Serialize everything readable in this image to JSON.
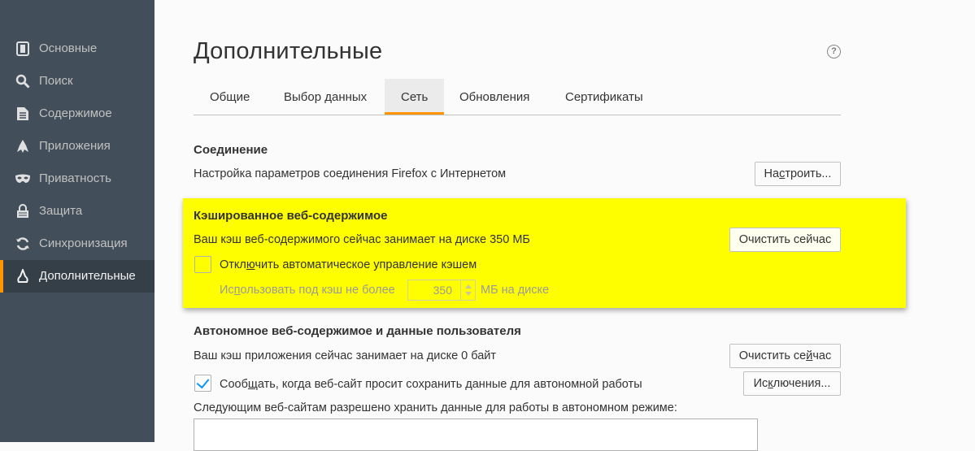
{
  "sidebar": {
    "items": [
      {
        "label": "Основные",
        "icon": "general-icon"
      },
      {
        "label": "Поиск",
        "icon": "search-icon"
      },
      {
        "label": "Содержимое",
        "icon": "content-icon"
      },
      {
        "label": "Приложения",
        "icon": "applications-icon"
      },
      {
        "label": "Приватность",
        "icon": "privacy-mask-icon"
      },
      {
        "label": "Защита",
        "icon": "security-icon"
      },
      {
        "label": "Синхронизация",
        "icon": "sync-icon"
      },
      {
        "label": "Дополнительные",
        "icon": "advanced-icon",
        "active": true
      }
    ]
  },
  "page": {
    "title": "Дополнительные",
    "help": "?"
  },
  "tabs": [
    {
      "label": "Общие"
    },
    {
      "label": "Выбор данных"
    },
    {
      "label": "Сеть",
      "selected": true
    },
    {
      "label": "Обновления"
    },
    {
      "label": "Сертификаты"
    }
  ],
  "connection": {
    "title": "Соединение",
    "description": "Настройка параметров соединения Firefox с Интернетом",
    "button_pre": "На",
    "button_key": "с",
    "button_post": "троить..."
  },
  "cache": {
    "title": "Кэшированное веб-содержимое",
    "usage": "Ваш кэш веб-содержимого сейчас занимает на диске 350 МБ",
    "clear_button": "Очистить сейчас",
    "override_label_pre": "Откл",
    "override_label_key": "ю",
    "override_label_post": "чить автоматическое управление кэшем",
    "override_checked": false,
    "limit_pre": "Ис",
    "limit_key": "п",
    "limit_post": "ользовать под кэш не более",
    "limit_value": "350",
    "limit_unit": "МБ на диске"
  },
  "offline": {
    "title": "Автономное веб-содержимое и данные пользователя",
    "usage": "Ваш кэш приложения сейчас занимает на диске 0 байт",
    "clear_button_pre": "Очистить се",
    "clear_button_key": "й",
    "clear_button_post": "час",
    "notify_label_pre": "Сооб",
    "notify_label_key": "щ",
    "notify_label_post": "ать, когда веб-сайт просит сохранить данные для автономной работы",
    "notify_checked": true,
    "exceptions_pre": "Ис",
    "exceptions_key": "к",
    "exceptions_post": "лючения...",
    "allowed_sites_label": "Следующим веб-сайтам разрешено хранить данные для работы в автономном режиме:"
  },
  "colors": {
    "sidebar_bg": "#424f5a",
    "accent": "#ff9500",
    "highlight": "#fefe00",
    "check": "#0996f8"
  }
}
